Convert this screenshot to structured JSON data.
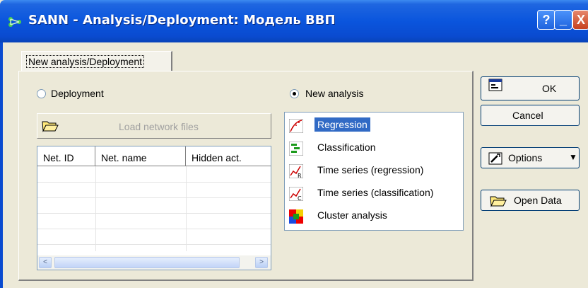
{
  "window": {
    "title": "SANN - Analysis/Deployment: Модель ВВП",
    "help_btn": "?",
    "min_btn": "_",
    "close_btn": "X"
  },
  "tab": {
    "label": "New analysis/Deployment"
  },
  "radios": {
    "deployment": {
      "label": "Deployment",
      "checked": false
    },
    "new_analysis": {
      "label": "New analysis",
      "checked": true
    }
  },
  "load_button": {
    "label": "Load network files",
    "enabled": false
  },
  "table": {
    "columns": [
      "Net. ID",
      "Net. name",
      "Hidden act."
    ],
    "rows": [],
    "scroll_left": "<",
    "scroll_right": ">"
  },
  "analysis_list": {
    "selected": "Regression",
    "items": [
      {
        "label": "Regression",
        "icon": "regression-icon"
      },
      {
        "label": "Classification",
        "icon": "classification-icon"
      },
      {
        "label": "Time series (regression)",
        "icon": "timeseries-regression-icon"
      },
      {
        "label": "Time series (classification)",
        "icon": "timeseries-classification-icon"
      },
      {
        "label": "Cluster analysis",
        "icon": "cluster-analysis-icon"
      }
    ]
  },
  "buttons": {
    "ok": "OK",
    "cancel": "Cancel",
    "options": "Options",
    "open_data": "Open Data"
  },
  "colors": {
    "titlebar": "#0a55dd",
    "selection": "#316ac5",
    "dialog_bg": "#ece9d8"
  }
}
